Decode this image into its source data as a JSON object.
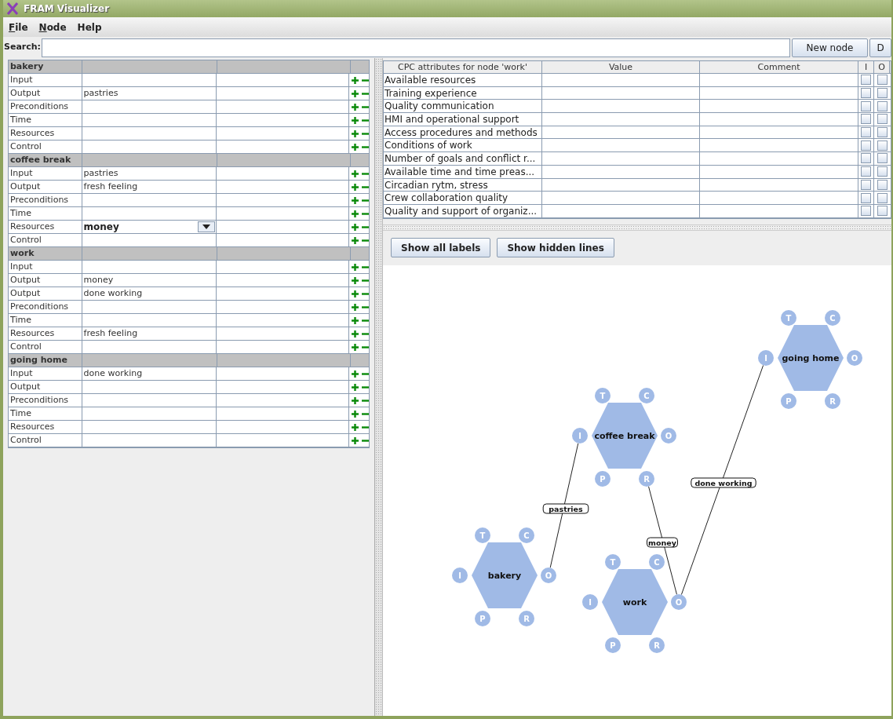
{
  "window": {
    "title": "FRAM Visualizer"
  },
  "menu": [
    {
      "label": "File",
      "underlined_first": true
    },
    {
      "label": "Node",
      "underlined_first": true
    },
    {
      "label": "Help",
      "underlined_first": false
    }
  ],
  "search": {
    "label": "Search:"
  },
  "toolbar_buttons": [
    "New node",
    "D"
  ],
  "functions": [
    {
      "name": "bakery",
      "aspects": [
        {
          "label": "Input",
          "kind": "text"
        },
        {
          "label": "Output",
          "value": "pastries",
          "kind": "text"
        },
        {
          "label": "Preconditions",
          "kind": "text"
        },
        {
          "label": "Time",
          "kind": "text"
        },
        {
          "label": "Resources",
          "kind": "text"
        },
        {
          "label": "Control",
          "kind": "text"
        }
      ]
    },
    {
      "name": "coffee break",
      "aspects": [
        {
          "label": "Input",
          "value": "pastries",
          "kind": "text"
        },
        {
          "label": "Output",
          "value": "fresh feeling",
          "kind": "text"
        },
        {
          "label": "Preconditions",
          "kind": "text"
        },
        {
          "label": "Time",
          "kind": "text"
        },
        {
          "label": "Resources",
          "value": "money",
          "kind": "dropdown"
        },
        {
          "label": "Control",
          "kind": "text"
        }
      ]
    },
    {
      "name": "work",
      "aspects": [
        {
          "label": "Input",
          "kind": "text"
        },
        {
          "label": "Output",
          "value": "money",
          "kind": "text"
        },
        {
          "label": "Output",
          "value": "done working",
          "kind": "text"
        },
        {
          "label": "Preconditions",
          "kind": "text"
        },
        {
          "label": "Time",
          "kind": "text"
        },
        {
          "label": "Resources",
          "value": "fresh feeling",
          "kind": "text"
        },
        {
          "label": "Control",
          "kind": "text"
        }
      ]
    },
    {
      "name": "going home",
      "aspects": [
        {
          "label": "Input",
          "value": "done working",
          "kind": "text"
        },
        {
          "label": "Output",
          "kind": "text"
        },
        {
          "label": "Preconditions",
          "kind": "text"
        },
        {
          "label": "Time",
          "kind": "text"
        },
        {
          "label": "Resources",
          "kind": "text"
        },
        {
          "label": "Control",
          "kind": "text"
        }
      ]
    }
  ],
  "cpc_table": {
    "columns": [
      "CPC attributes for node 'work'",
      "Value",
      "Comment",
      "I",
      "O"
    ],
    "rows": [
      {
        "attribute": "Available resources",
        "input": false,
        "output": false
      },
      {
        "attribute": "Training experience",
        "input": false,
        "output": false
      },
      {
        "attribute": "Quality communication",
        "input": false,
        "output": false
      },
      {
        "attribute": "HMI and operational support",
        "input": false,
        "output": false
      },
      {
        "attribute": "Access procedures and methods",
        "input": false,
        "output": false
      },
      {
        "attribute": "Conditions of work",
        "input": false,
        "output": false
      },
      {
        "attribute": "Number of goals and conflict r...",
        "input": false,
        "output": false
      },
      {
        "attribute": "Available time and time preas...",
        "input": false,
        "output": false
      },
      {
        "attribute": "Circadian rytm, stress",
        "input": false,
        "output": false
      },
      {
        "attribute": "Crew collaboration quality",
        "input": false,
        "output": false
      },
      {
        "attribute": "Quality and support of organiz...",
        "input": false,
        "output": false
      }
    ]
  },
  "graph_buttons": [
    "Show all labels",
    "Show hidden lines"
  ],
  "graph": {
    "nodes": [
      {
        "name": "bakery",
        "ports": [
          "T",
          "C",
          "I",
          "O",
          "P",
          "R"
        ]
      },
      {
        "name": "coffee break",
        "ports": [
          "T",
          "C",
          "I",
          "O",
          "P",
          "R"
        ]
      },
      {
        "name": "work",
        "ports": [
          "T",
          "C",
          "I",
          "O",
          "P",
          "R"
        ]
      },
      {
        "name": "going home",
        "ports": [
          "T",
          "C",
          "I",
          "O",
          "P",
          "R"
        ]
      }
    ],
    "edges": [
      {
        "label": "pastries"
      },
      {
        "label": "money"
      },
      {
        "label": "done working"
      }
    ]
  }
}
